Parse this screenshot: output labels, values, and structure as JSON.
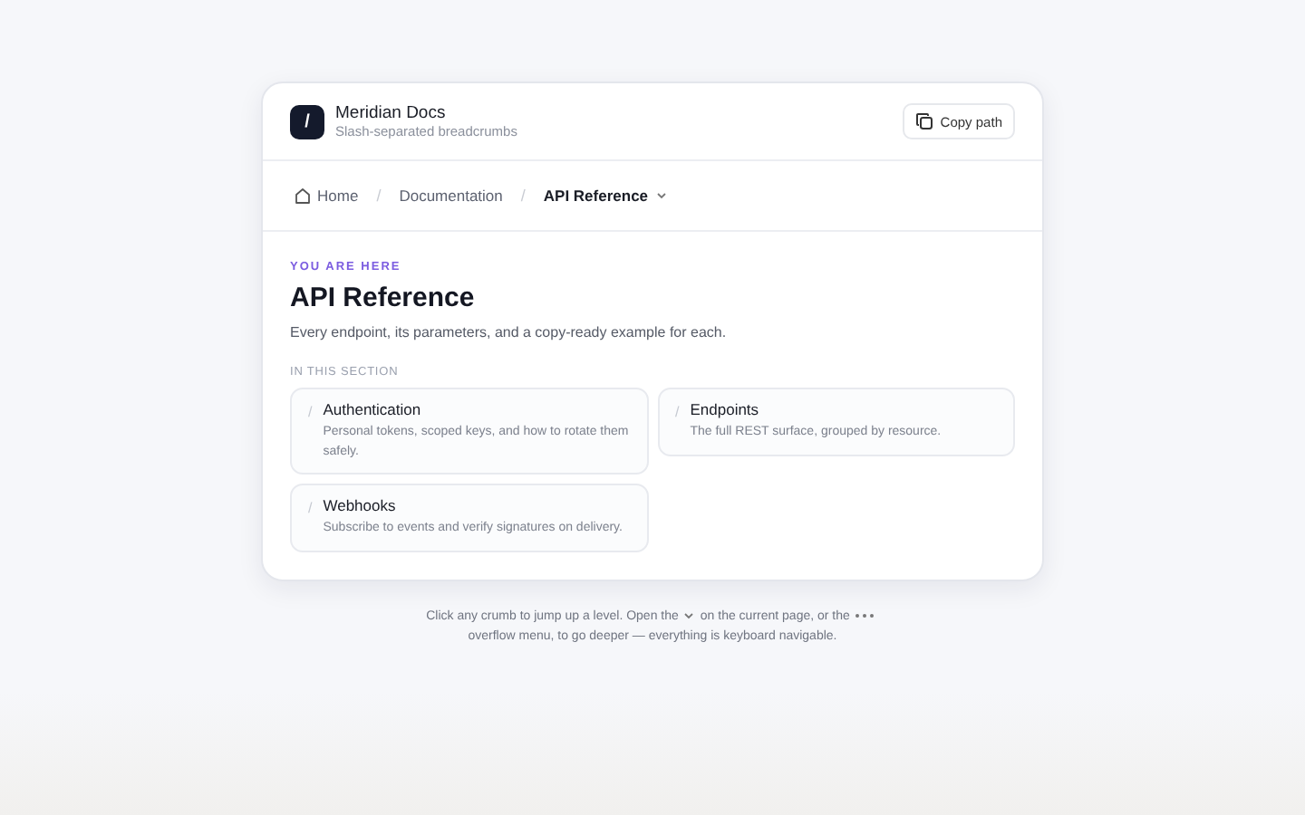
{
  "header": {
    "logo": "/",
    "title": "Meridian Docs",
    "subtitle": "Slash-separated breadcrumbs",
    "copy_button": "Copy path"
  },
  "breadcrumbs": [
    {
      "label": "Home",
      "kind": "home",
      "selected": false
    },
    {
      "label": "Documentation",
      "kind": "link",
      "selected": false
    },
    {
      "label": "API Reference",
      "kind": "current",
      "selected": true
    }
  ],
  "separator": "/",
  "eyebrow": "YOU ARE HERE",
  "title": "API Reference",
  "description": "Every endpoint, its parameters, and a copy-ready example for each.",
  "section_label": "IN THIS SECTION",
  "links": [
    {
      "mark": "/",
      "title": "Authentication",
      "text": "Personal tokens, scoped keys, and how to rotate them safely."
    },
    {
      "mark": "/",
      "title": "Endpoints",
      "text": "The full REST surface, grouped by resource."
    },
    {
      "mark": "/",
      "title": "Webhooks",
      "text": "Subscribe to events and verify signatures on delivery."
    }
  ],
  "footer": [
    "Click any crumb to jump up a level. Open the",
    "on the current page, or the",
    "overflow menu, to go deeper — everything is keyboard navigable."
  ]
}
